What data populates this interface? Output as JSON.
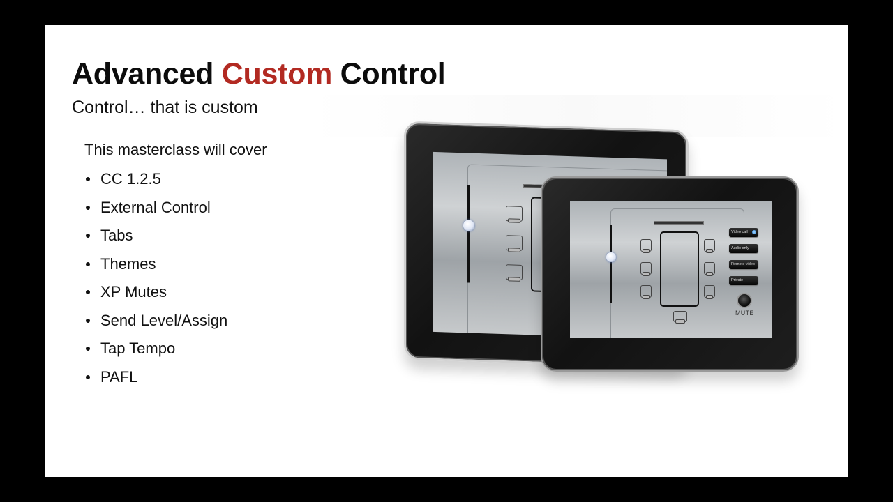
{
  "slide": {
    "title": {
      "part1": "Advanced ",
      "accent": "Custom",
      "part2": " Control"
    },
    "subtitle": "Control… that is custom",
    "intro": "This masterclass will cover",
    "bullets": [
      "CC 1.2.5",
      "External Control",
      "Tabs",
      "Themes",
      "XP Mutes",
      "Send Level/Assign",
      "Tap Tempo",
      "PAFL"
    ],
    "accent_color": "#b22a22"
  },
  "tablet_ui": {
    "mode_buttons": [
      "Video call",
      "Audio only",
      "Remote video",
      "Private"
    ],
    "active_mode": "Video call",
    "mute_label": "MUTE"
  }
}
